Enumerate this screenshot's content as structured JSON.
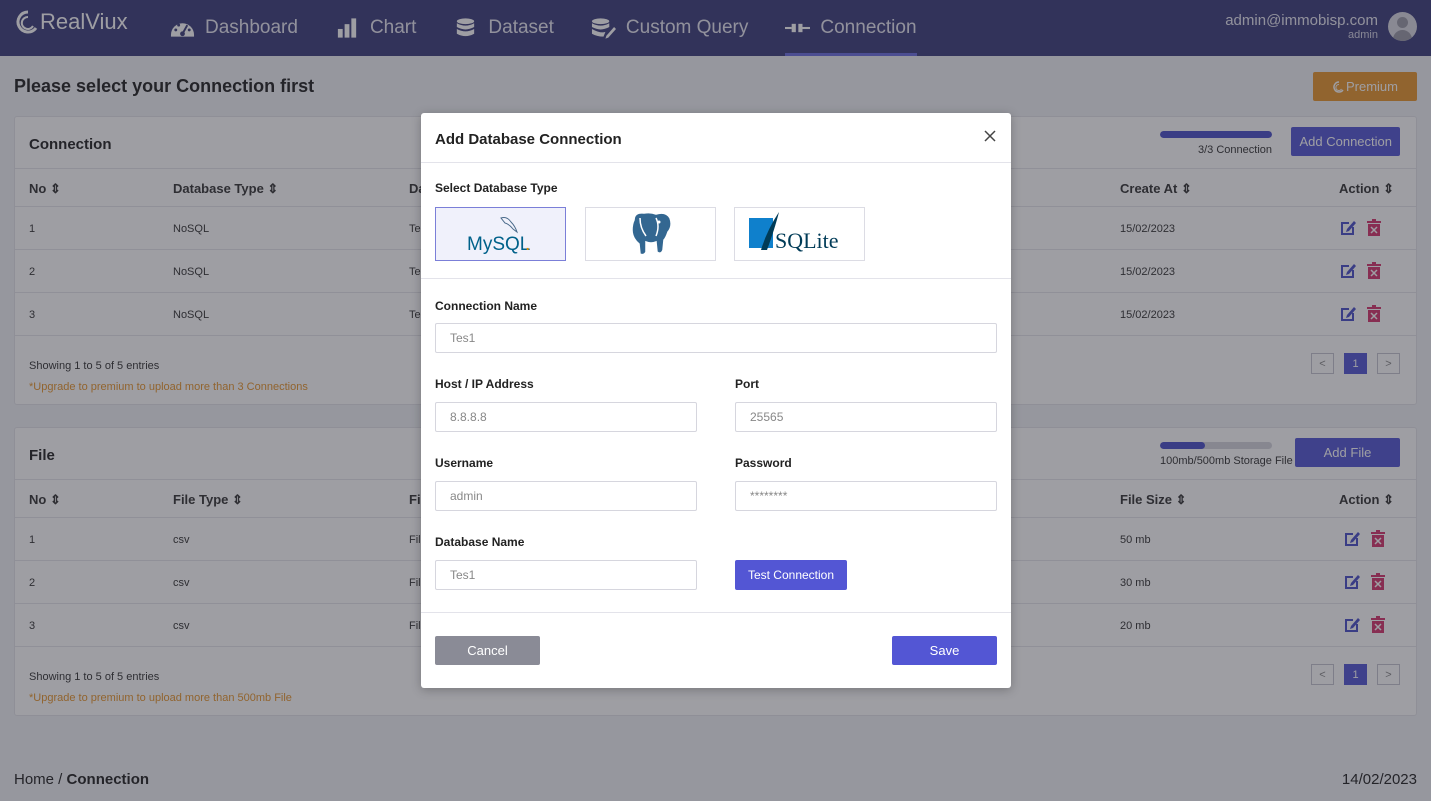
{
  "app": {
    "brand": "RealViux",
    "nav": [
      {
        "label": "Dashboard",
        "icon": "dashboard-gauge-icon"
      },
      {
        "label": "Chart",
        "icon": "bar-chart-icon"
      },
      {
        "label": "Dataset",
        "icon": "database-icon"
      },
      {
        "label": "Custom Query",
        "icon": "database-edit-icon"
      },
      {
        "label": "Connection",
        "icon": "plug-connection-icon",
        "active": true
      }
    ],
    "user": {
      "email": "admin@immobisp.com",
      "role": "admin"
    }
  },
  "page": {
    "title": "Please select your Connection first",
    "premium_label": "Premium"
  },
  "connection_card": {
    "title": "Connection",
    "usage_label": "3/3 Connection",
    "usage_fraction": 1.0,
    "add_label": "Add Connection",
    "columns": [
      "No",
      "Database Type",
      "Da",
      "Create At",
      "Action"
    ],
    "rows": [
      {
        "no": "1",
        "type": "NoSQL",
        "name": "Te",
        "created": "15/02/2023"
      },
      {
        "no": "2",
        "type": "NoSQL",
        "name": "Te",
        "created": "15/02/2023"
      },
      {
        "no": "3",
        "type": "NoSQL",
        "name": "Te",
        "created": "15/02/2023"
      }
    ],
    "showing": "Showing 1 to 5 of 5 entries",
    "upgrade_note": "*Upgrade to premium to upload more than 3 Connections",
    "pager": {
      "prev": "<",
      "current": "1",
      "next": ">"
    }
  },
  "file_card": {
    "title": "File",
    "usage_label": "100mb/500mb Storage File",
    "usage_fraction": 0.4,
    "add_label": "Add File",
    "columns": [
      "No",
      "File Type",
      "Fi",
      "File Size",
      "Action"
    ],
    "rows": [
      {
        "no": "1",
        "type": "csv",
        "name": "Fil",
        "size": "50 mb"
      },
      {
        "no": "2",
        "type": "csv",
        "name": "Fil",
        "size": "30 mb"
      },
      {
        "no": "3",
        "type": "csv",
        "name": "Fil",
        "size": "20 mb"
      }
    ],
    "showing": "Showing 1 to 5 of 5 entries",
    "upgrade_note": "*Upgrade to premium to upload more than 500mb File",
    "pager": {
      "prev": "<",
      "current": "1",
      "next": ">"
    }
  },
  "footer": {
    "home": "Home",
    "separator": " / ",
    "current": "Connection",
    "date": "14/02/2023"
  },
  "modal": {
    "title": "Add Database Connection",
    "select_type_label": "Select Database Type",
    "db_types": [
      {
        "name": "MySQL",
        "selected": true
      },
      {
        "name": "PostgreSQL",
        "selected": false
      },
      {
        "name": "SQLite",
        "selected": false
      }
    ],
    "mysql_logo_text": "MySQL",
    "mysql_tm": ".",
    "sqlite_logo_text": "SQLite",
    "fields": {
      "connection_name": {
        "label": "Connection Name",
        "value": "Tes1"
      },
      "host": {
        "label": "Host / IP Address",
        "value": "8.8.8.8"
      },
      "port": {
        "label": "Port",
        "value": "25565"
      },
      "username": {
        "label": "Username",
        "value": "admin"
      },
      "password": {
        "label": "Password",
        "value": "********"
      },
      "database_name": {
        "label": "Database Name",
        "value": "Tes1"
      }
    },
    "test_label": "Test Connection",
    "cancel_label": "Cancel",
    "save_label": "Save"
  }
}
